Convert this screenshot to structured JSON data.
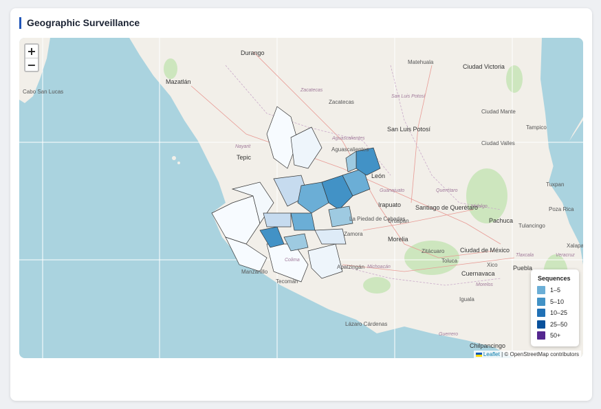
{
  "card": {
    "title": "Geographic Surveillance"
  },
  "map": {
    "zoom_in": "+",
    "zoom_out": "−",
    "attribution_link": "Leaflet",
    "attribution_text": "| © OpenStreetMap contributors",
    "places": [
      {
        "name": "Durango",
        "cls": "big"
      },
      {
        "name": "Matehuala",
        "cls": ""
      },
      {
        "name": "Ciudad Victoria",
        "cls": "big"
      },
      {
        "name": "Mazatlán",
        "cls": "big"
      },
      {
        "name": "Zacatecas",
        "cls": "state"
      },
      {
        "name": "Zacatecas",
        "cls": ""
      },
      {
        "name": "San Luis Potosí",
        "cls": "state"
      },
      {
        "name": "Cabo San Lucas",
        "cls": ""
      },
      {
        "name": "Ciudad Mante",
        "cls": ""
      },
      {
        "name": "Tampico",
        "cls": ""
      },
      {
        "name": "San Luis Potosí",
        "cls": "big"
      },
      {
        "name": "Aguascalientes",
        "cls": "state"
      },
      {
        "name": "Nayarit",
        "cls": "state"
      },
      {
        "name": "Aguascalientes",
        "cls": ""
      },
      {
        "name": "Ciudad Valles",
        "cls": ""
      },
      {
        "name": "Tepic",
        "cls": "big"
      },
      {
        "name": "León",
        "cls": "big"
      },
      {
        "name": "Guanajuato",
        "cls": "state"
      },
      {
        "name": "Querétaro",
        "cls": "state"
      },
      {
        "name": "Tuxpan",
        "cls": ""
      },
      {
        "name": "Irapuato",
        "cls": "big"
      },
      {
        "name": "Hidalgo",
        "cls": "state"
      },
      {
        "name": "Poza Rica",
        "cls": ""
      },
      {
        "name": "Santiago de Querétaro",
        "cls": "big"
      },
      {
        "name": "La Piedad de Cabadas",
        "cls": ""
      },
      {
        "name": "Uruapan",
        "cls": ""
      },
      {
        "name": "Pachuca",
        "cls": "big"
      },
      {
        "name": "Tulancingo",
        "cls": ""
      },
      {
        "name": "Zamora",
        "cls": ""
      },
      {
        "name": "Morelia",
        "cls": "big"
      },
      {
        "name": "Xalapa",
        "cls": ""
      },
      {
        "name": "Zitácuaro",
        "cls": ""
      },
      {
        "name": "Ciudad de México",
        "cls": "big"
      },
      {
        "name": "Veracruz",
        "cls": "state"
      },
      {
        "name": "Colima",
        "cls": "state"
      },
      {
        "name": "Toluca",
        "cls": ""
      },
      {
        "name": "Xico",
        "cls": ""
      },
      {
        "name": "Tlaxcala",
        "cls": "state"
      },
      {
        "name": "Apatzingán",
        "cls": ""
      },
      {
        "name": "Michoacán",
        "cls": "state"
      },
      {
        "name": "Puebla",
        "cls": "big"
      },
      {
        "name": "Manzanillo",
        "cls": ""
      },
      {
        "name": "Cuernavaca",
        "cls": "big"
      },
      {
        "name": "Tecomán",
        "cls": ""
      },
      {
        "name": "Morelos",
        "cls": "state"
      },
      {
        "name": "Iguala",
        "cls": ""
      },
      {
        "name": "Lázaro Cárdenas",
        "cls": ""
      },
      {
        "name": "Guerrero",
        "cls": "state"
      },
      {
        "name": "Chilpancingo",
        "cls": "big"
      }
    ]
  },
  "legend": {
    "title": "Sequences",
    "items": [
      {
        "label": "1–5",
        "color": "#6baed6"
      },
      {
        "label": "5–10",
        "color": "#4292c6"
      },
      {
        "label": "10–25",
        "color": "#2171b5"
      },
      {
        "label": "25–50",
        "color": "#08519c"
      },
      {
        "label": "50+",
        "color": "#54278f"
      }
    ]
  },
  "colors": {
    "water": "#aad3df",
    "land": "#f2efe9",
    "accent": "#2156b8",
    "region_fill_low": "#f7fbff",
    "region_stroke": "#333333"
  }
}
